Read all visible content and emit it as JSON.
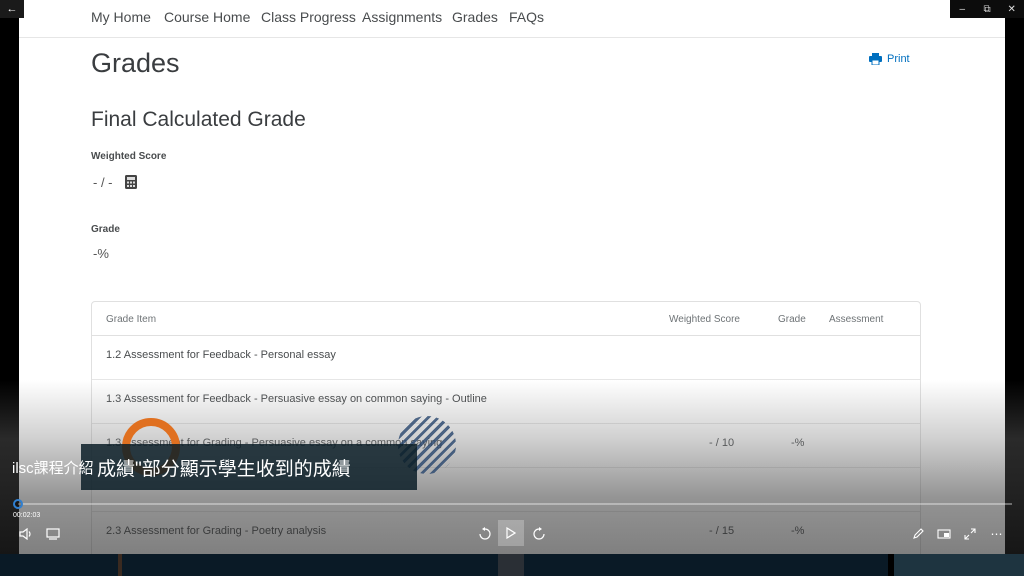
{
  "nav": {
    "items": [
      "My Home",
      "Course Home",
      "Class Progress",
      "Assignments",
      "Grades",
      "FAQs"
    ]
  },
  "page": {
    "title": "Grades",
    "print_label": "Print",
    "section_title": "Final Calculated Grade",
    "weighted_score_label": "Weighted Score",
    "weighted_score_value": "- / -",
    "grade_label": "Grade",
    "grade_value": "-%"
  },
  "table": {
    "headers": [
      "Grade Item",
      "Weighted Score",
      "Grade",
      "Assessment"
    ],
    "rows": [
      {
        "name": "1.2 Assessment for Feedback - Personal essay",
        "weighted": "",
        "grade": ""
      },
      {
        "name": "1.3 Assessment for Feedback - Persuasive essay on common saying - Outline",
        "weighted": "",
        "grade": ""
      },
      {
        "name": "1.3 Assessment for Grading - Persuasive essay on a common saying",
        "weighted": "- / 10",
        "grade": "-%"
      },
      {
        "name": "",
        "weighted": "",
        "grade": ""
      },
      {
        "name": "2.3 Assessment for Grading - Poetry analysis",
        "weighted": "- / 15",
        "grade": "-%"
      }
    ]
  },
  "video": {
    "title": "ilsc課程介紹",
    "caption": "成績\"部分顯示學生收到的成績",
    "time": "00:02:03"
  },
  "colors": {
    "accent": "#006fbf",
    "scrubber": "#2f7fd0",
    "ring": "#e07020"
  }
}
